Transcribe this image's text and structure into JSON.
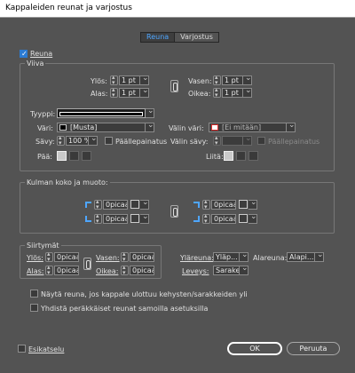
{
  "window": {
    "title": "Kappaleiden reunat ja varjostus"
  },
  "tabs": [
    {
      "label": "Reuna",
      "active": true
    },
    {
      "label": "Varjostus",
      "active": false
    }
  ],
  "reuna": {
    "label": "Reuna",
    "checked": true
  },
  "viiva": {
    "group_label": "Viiva",
    "ylos": {
      "label": "Ylös:",
      "value": "1 pt"
    },
    "alas": {
      "label": "Alas:",
      "value": "1 pt"
    },
    "vasen": {
      "label": "Vasen:",
      "value": "1 pt"
    },
    "oikea": {
      "label": "Oikea:",
      "value": "1 pt"
    },
    "tyyppi": {
      "label": "Tyyppi:"
    },
    "vari": {
      "label": "Väri:",
      "value": "[Musta]"
    },
    "valin_vari": {
      "label": "Välin väri:",
      "value": "[Ei mitään]"
    },
    "savy": {
      "label": "Sävy:",
      "value": "100 %"
    },
    "paallepainatus": {
      "label": "Päällepainatus"
    },
    "valin_savy": {
      "label": "Välin sävy:"
    },
    "valin_paallepainatus": {
      "label": "Päällepainatus"
    },
    "paa": {
      "label": "Pää:"
    },
    "liita": {
      "label": "Liitä:"
    }
  },
  "kulma": {
    "group_label": "Kulman koko ja muoto:",
    "tl": "0picaa1",
    "bl": "0picaa1",
    "tr": "0picaa",
    "br": "0picaa"
  },
  "siirtymat": {
    "group_label": "Siirtymät",
    "ylos": {
      "label": "Ylös:",
      "value": "0picaa"
    },
    "alas": {
      "label": "Alas:",
      "value": "0picaa"
    },
    "vasen": {
      "label": "Vasen:",
      "value": "0picaa"
    },
    "oikea": {
      "label": "Oikea:",
      "value": "0picaa"
    },
    "ylareuna": {
      "label": "Yläreuna:",
      "value": "Yläp..."
    },
    "alareuna": {
      "label": "Alareuna:",
      "value": "Alapi..."
    },
    "leveys": {
      "label": "Leveys:",
      "value": "Sarake"
    }
  },
  "options": {
    "nayta_reuna": "Näytä reuna, jos kappale ulottuu kehysten/sarakkeiden yli",
    "yhdista": "Yhdistä peräkkäiset reunat samoilla asetuksilla"
  },
  "footer": {
    "esikatselu": "Esikatselu",
    "ok": "OK",
    "peruuta": "Peruuta"
  }
}
